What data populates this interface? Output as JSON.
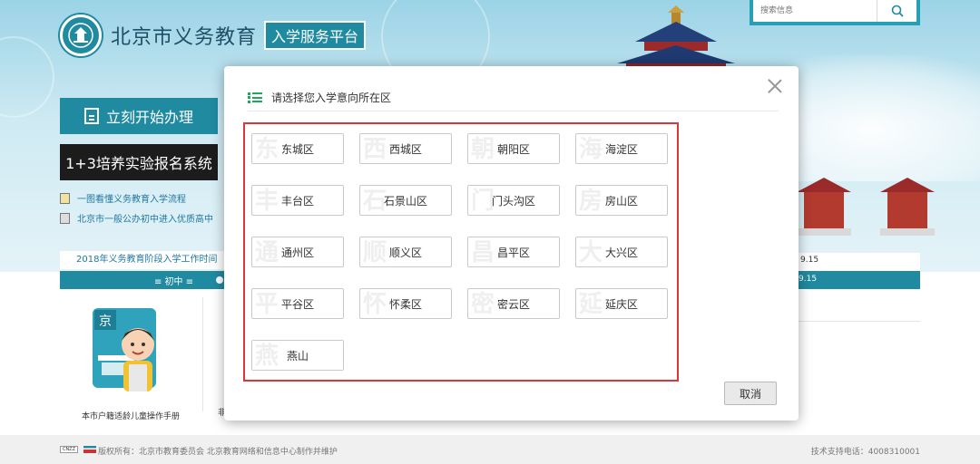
{
  "header": {
    "site_name": "北京市义务教育",
    "site_badge": "入学服务平台",
    "search_placeholder": "搜索信息"
  },
  "sidebar": {
    "start_button": "立刻开始办理",
    "experiment_button": "1+3培养实验报名系统",
    "links": [
      {
        "label": "一图看懂义务教育入学流程",
        "icon": "document-icon"
      },
      {
        "label": "北京市一般公办初中进入优质高中",
        "icon": "search-doc-icon"
      }
    ],
    "notice": "2018年义务教育阶段入学工作时间",
    "level_tab": "≡ 初中 ≡"
  },
  "right_panel": {
    "date_top": "9.15",
    "date_band": "9.15"
  },
  "content": {
    "guide_badge": "京",
    "guide_title": "本市户籍适龄儿童操作手册",
    "next_fragment": "非"
  },
  "modal": {
    "title": "请选择您入学意向所在区",
    "cancel_label": "取消",
    "districts": [
      {
        "label": "东城区",
        "mark": "东"
      },
      {
        "label": "西城区",
        "mark": "西"
      },
      {
        "label": "朝阳区",
        "mark": "朝"
      },
      {
        "label": "海淀区",
        "mark": "海"
      },
      {
        "label": "丰台区",
        "mark": "丰"
      },
      {
        "label": "石景山区",
        "mark": "石"
      },
      {
        "label": "门头沟区",
        "mark": "门"
      },
      {
        "label": "房山区",
        "mark": "房"
      },
      {
        "label": "通州区",
        "mark": "通"
      },
      {
        "label": "顺义区",
        "mark": "顺"
      },
      {
        "label": "昌平区",
        "mark": "昌"
      },
      {
        "label": "大兴区",
        "mark": "大"
      },
      {
        "label": "平谷区",
        "mark": "平"
      },
      {
        "label": "怀柔区",
        "mark": "怀"
      },
      {
        "label": "密云区",
        "mark": "密"
      },
      {
        "label": "延庆区",
        "mark": "延"
      },
      {
        "label": "燕山",
        "mark": "燕"
      }
    ]
  },
  "footer": {
    "cnzz": "CNZZ",
    "copyright": "版权所有：北京市教育委员会 北京教育网络和信息中心制作并维护",
    "support": "技术支持电话：4008310001"
  },
  "colors": {
    "brand_teal": "#1f8aa0",
    "highlight_red": "#d9373a",
    "list_icon_green": "#1ea85a"
  }
}
